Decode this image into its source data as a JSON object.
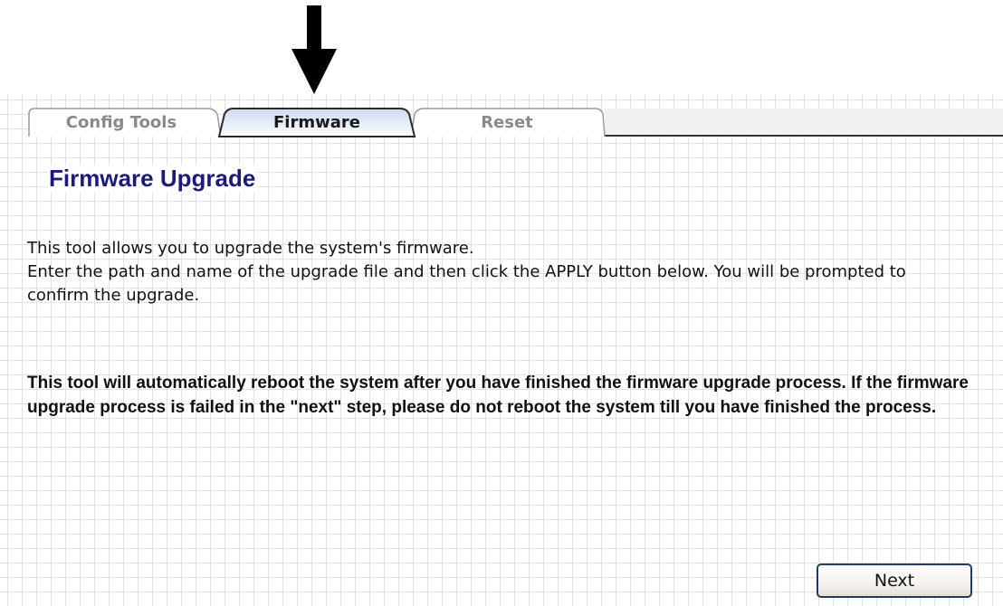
{
  "tabs": [
    {
      "label": "Config Tools",
      "active": false
    },
    {
      "label": "Firmware",
      "active": true
    },
    {
      "label": "Reset",
      "active": false
    }
  ],
  "page_title": "Firmware Upgrade",
  "description": {
    "line1": "This tool allows you to upgrade the system's firmware.",
    "line2": "Enter the path and name of the upgrade file and then click the APPLY button below. You will be prompted to confirm the upgrade."
  },
  "warning": "This tool will automatically reboot the system after you have finished the firmware upgrade process. If the firmware upgrade process is failed in the \"next\" step, please do not reboot the system till you have finished the process.",
  "buttons": {
    "next": "Next"
  },
  "icons": {
    "pointer": "down-arrow-icon"
  },
  "colors": {
    "title": "#1a1a80",
    "active_tab_top": "#c9daf0",
    "grid_line": "#e2e2e2",
    "button_border": "#1f3b6a"
  }
}
